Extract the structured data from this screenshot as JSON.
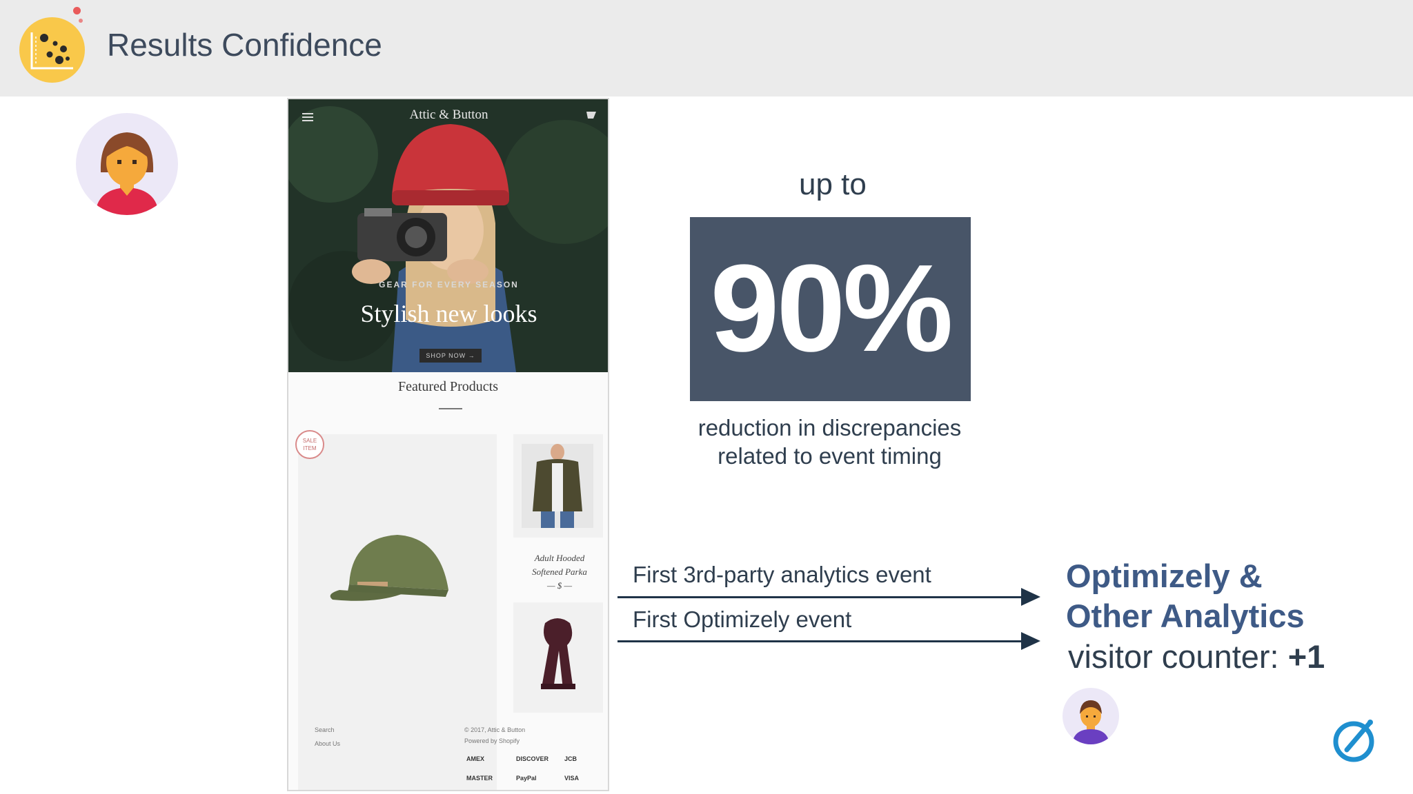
{
  "header": {
    "title": "Results Confidence",
    "logo_icon": "results-confidence-logo-icon",
    "logo_color": "#f9c84a"
  },
  "phone": {
    "store_name": "Attic & Button",
    "hero_subtitle": "GEAR FOR EVERY SEASON",
    "hero_headline": "Stylish new looks",
    "hero_button": "SHOP NOW →",
    "featured_heading": "Featured Products",
    "sale_badge": "SALE ITEM",
    "product_name_line1": "Adult Hooded",
    "product_name_line2": "Softened Parka",
    "product_price": "— $ —",
    "footer_links": [
      "Search",
      "About Us"
    ],
    "footer_copyright": [
      "© 2017, Attic & Button",
      "Powered by Shopify"
    ],
    "payment_methods": [
      "AMEX",
      "DISCOVER",
      "JCB",
      "MASTER",
      "PayPal",
      "VISA"
    ]
  },
  "stat": {
    "prefix": "up to",
    "value": "90%",
    "caption_line1": "reduction in discrepancies",
    "caption_line2": "related to event timing",
    "box_color": "#485568"
  },
  "events": [
    {
      "label": "First 3rd-party analytics event"
    },
    {
      "label": "First Optimizely event"
    }
  ],
  "result": {
    "title_line1": "Optimizely &",
    "title_line2": "Other Analytics",
    "counter_label": "visitor counter:",
    "counter_value": "+1",
    "title_color": "#3e5a86"
  },
  "brand_icon": "optimizely-logo-icon"
}
